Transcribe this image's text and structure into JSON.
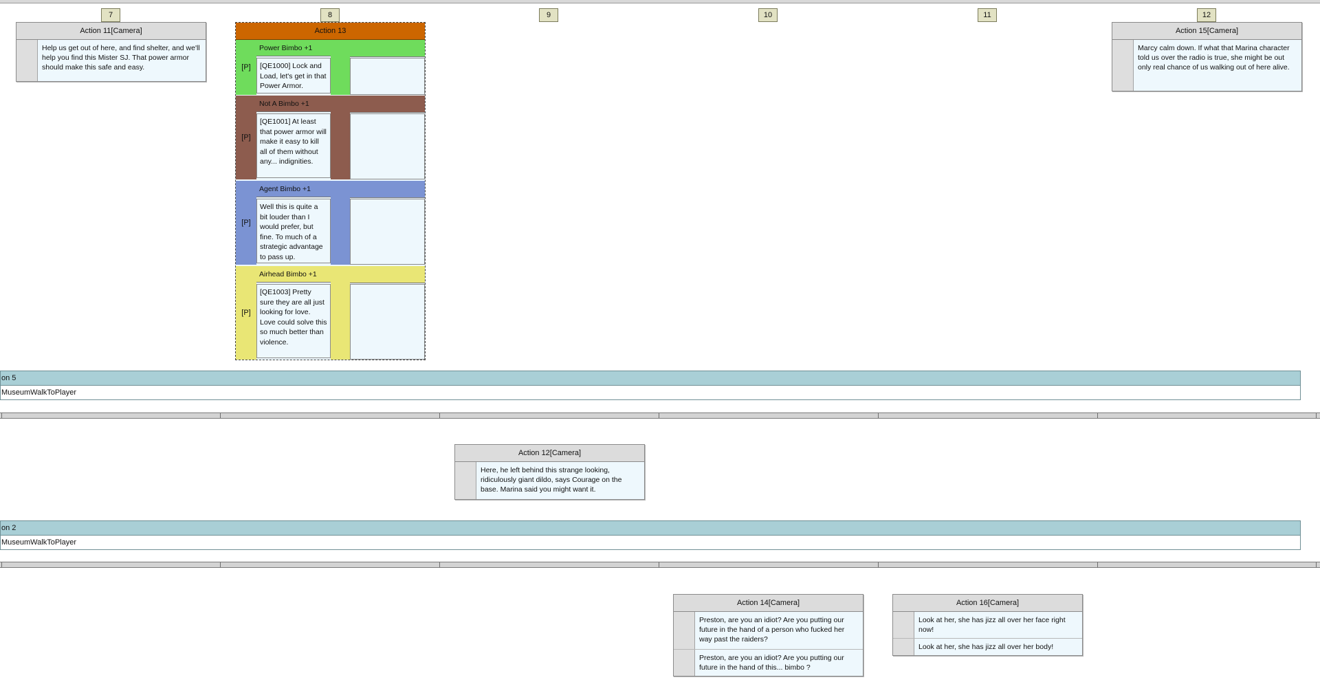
{
  "columns": [
    "7",
    "8",
    "9",
    "10",
    "11",
    "12"
  ],
  "actions": {
    "a11": {
      "title": "Action 11[Camera]",
      "lines": [
        "Help us get out of here, and find shelter, and we'll help you find this Mister SJ. That power armor should make this safe and easy."
      ]
    },
    "a15": {
      "title": "Action 15[Camera]",
      "lines": [
        "Marcy calm down. If what that Marina character told us over the radio is true, she might be out only real chance of us walking out of here alive."
      ]
    },
    "a12": {
      "title": "Action 12[Camera]",
      "lines": [
        "Here, he left behind this strange looking, ridiculously giant dildo, says Courage on the base. Marina said you might want it."
      ]
    },
    "a14": {
      "title": "Action 14[Camera]",
      "lines": [
        "Preston, are you an idiot? Are you putting our future in the hand of a person who fucked her way past the raiders?",
        "Preston, are you an idiot? Are you putting our future in the hand of this... bimbo ?"
      ]
    },
    "a16": {
      "title": "Action 16[Camera]",
      "lines": [
        "Look at her, she has jizz all over her face right now!",
        "Look at her, she has jizz all over her body!"
      ]
    }
  },
  "action13": {
    "title": "Action 13",
    "choices": [
      {
        "label": "Power Bimbo +1",
        "marker": "[P]",
        "text": "[QE1000] Lock and Load, let's get in that Power Armor.",
        "color": "#6fdc5c"
      },
      {
        "label": "Not A Bimbo +1",
        "marker": "[P]",
        "text": "[QE1001] At least that power armor will make it easy to kill all of them without any... indignities.",
        "color": "#8d5c4e"
      },
      {
        "label": "Agent Bimbo +1",
        "marker": "[P]",
        "text": "Well this is quite a bit louder than I would prefer, but fine. To much of a strategic advantage to pass up.",
        "color": "#7b93d3"
      },
      {
        "label": "Airhead Bimbo +1",
        "marker": "[P]",
        "text": "[QE1003] Pretty sure they are all just looking for love. Love could solve this so much better than violence.",
        "color": "#e9e675"
      }
    ]
  },
  "bands": [
    {
      "title": "on 5",
      "body": "MuseumWalkToPlayer"
    },
    {
      "title": "on 2",
      "body": "MuseumWalkToPlayer"
    }
  ],
  "colors": {
    "header_orange": "#cc6600",
    "band_teal": "#a9cfd6",
    "card_bg": "#eef8fd"
  }
}
